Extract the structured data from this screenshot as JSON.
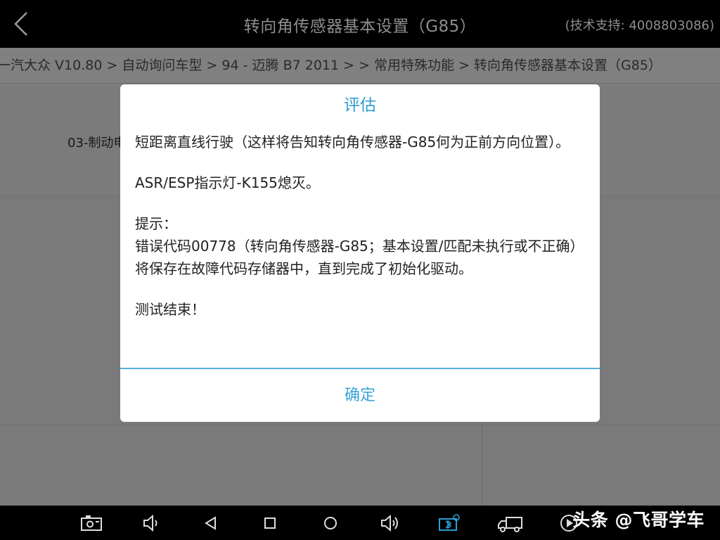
{
  "header": {
    "title": "转向角传感器基本设置（G85）",
    "support": "(技术支持: 4008803086)",
    "back_icon": "chevron-left-icon"
  },
  "breadcrumb": "一汽大众 V10.80 > 自动询问车型 > 94 - 迈腾 B7 2011 > > 常用特殊功能 > 转向角传感器基本设置（G85）",
  "background": {
    "row_label": "03-制动电"
  },
  "dialog": {
    "title": "评估",
    "paragraphs": [
      "短距离直线行驶（这样将告知转向角传感器-G85何为正前方向位置）。",
      "ASR/ESP指示灯-K155熄灭。",
      "提示：\n错误代码00778（转向角传感器-G85；基本设置/匹配未执行或不正确）将保存在故障代码存储器中，直到完成了初始化驱动。",
      "测试结束！"
    ],
    "ok_label": "确定"
  },
  "navbar": {
    "icons": [
      "screenshot-icon",
      "volume-down-icon",
      "back-triangle-icon",
      "home-square-icon",
      "recents-circle-icon",
      "volume-up-icon",
      "vci-bluetooth-icon",
      "truck-icon",
      "play-icon"
    ],
    "accent_color": "#2f9bd1"
  },
  "watermark": "头条 @飞哥学车"
}
